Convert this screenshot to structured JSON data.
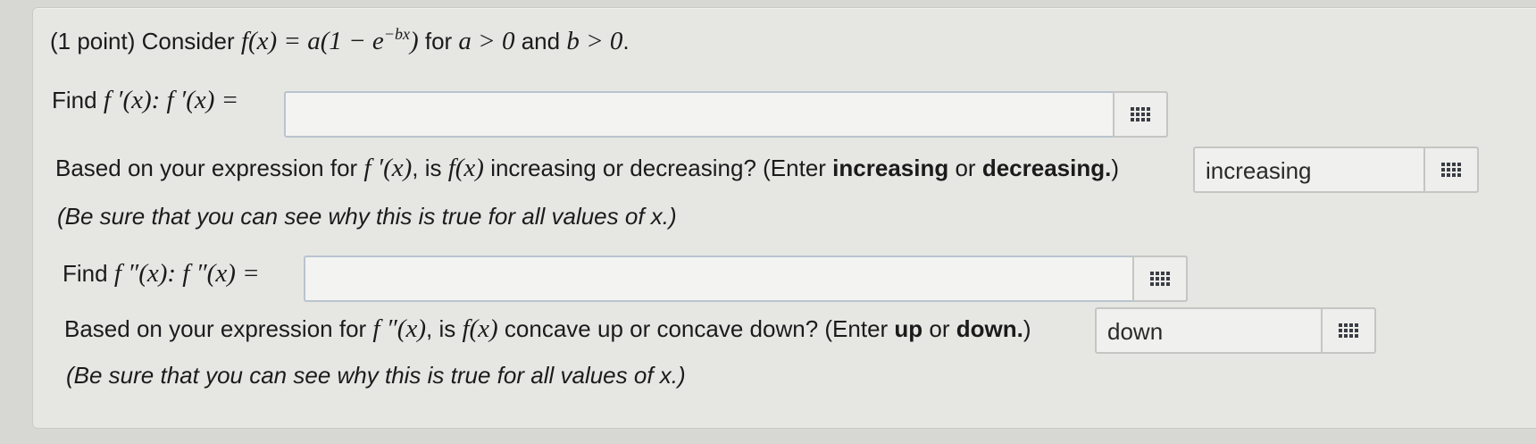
{
  "problem": {
    "points": "(1 point) Consider ",
    "function_def": "f(x) = a(1 − e",
    "exponent": "−bx",
    "function_close": ")",
    "for_text": " for ",
    "cond_a": "a > 0",
    "and_text": " and ",
    "cond_b": "b > 0",
    "period": "."
  },
  "part1": {
    "find_label": "Find ",
    "math": "f ′(x): f ′(x) =",
    "answer_value": "",
    "question_prefix": "Based on your expression for ",
    "question_math": "f ′(x)",
    "question_mid": ", is ",
    "question_math2": "f(x)",
    "question_rest": " increasing or decreasing? (Enter ",
    "bold1": "increasing",
    "or_text": " or ",
    "bold2": "decreasing.",
    "close": ")",
    "select_value": "increasing",
    "note": "(Be sure that you can see why this is true for all values of x.)"
  },
  "part2": {
    "find_label": "Find ",
    "math": "f ″(x): f ″(x) =",
    "answer_value": "",
    "question_prefix": "Based on your expression for ",
    "question_math": "f ″(x)",
    "question_mid": ", is ",
    "question_math2": "f(x)",
    "question_rest": " concave up or concave down? (Enter ",
    "bold1": "up",
    "or_text": " or ",
    "bold2": "down.",
    "close": ")",
    "select_value": "down",
    "note": "(Be sure that you can see why this is true for all values of x.)"
  },
  "icons": {
    "keyboard": "keyboard-icon"
  }
}
